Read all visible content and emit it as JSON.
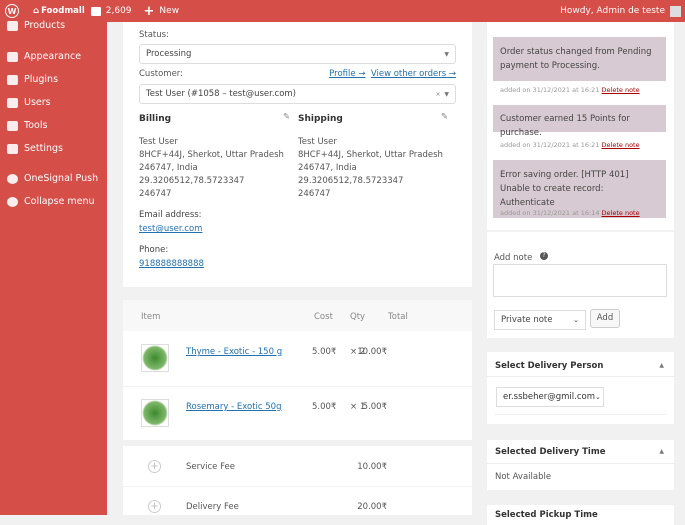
{
  "topbar": {
    "site": "Foodmall",
    "comments": "2,609",
    "new": "New",
    "greeting": "Howdy, Admin de teste"
  },
  "sidebar": {
    "items": [
      {
        "label": "Products",
        "icon": "products-icon"
      },
      {
        "label": "Appearance",
        "icon": "appearance-icon"
      },
      {
        "label": "Plugins",
        "icon": "plugins-icon"
      },
      {
        "label": "Users",
        "icon": "users-icon"
      },
      {
        "label": "Tools",
        "icon": "tools-icon"
      },
      {
        "label": "Settings",
        "icon": "settings-icon"
      },
      {
        "label": "OneSignal Push",
        "icon": "onesignal-icon"
      },
      {
        "label": "Collapse menu",
        "icon": "collapse-icon"
      }
    ]
  },
  "order": {
    "status_label": "Status:",
    "status": "Processing",
    "customer_label": "Customer:",
    "profile_link": "Profile →",
    "other_orders_link": "View other orders →",
    "customer": "Test User (#1058 – test@user.com)",
    "billing": {
      "title": "Billing",
      "lines": [
        "Test User",
        "8HCF+44J, Sherkot, Uttar Pradesh",
        "246747, India",
        "29.3206512,78.5723347",
        "246747"
      ]
    },
    "shipping": {
      "title": "Shipping",
      "lines": [
        "Test User",
        "8HCF+44J, Sherkot, Uttar Pradesh",
        "246747, India",
        "29.3206512,78.5723347",
        "246747"
      ]
    },
    "email_label": "Email address:",
    "email": "test@user.com",
    "phone_label": "Phone:",
    "phone": "918888888888"
  },
  "items": {
    "headers": {
      "item": "Item",
      "cost": "Cost",
      "qty": "Qty",
      "total": "Total"
    },
    "rows": [
      {
        "name": "Thyme - Exotic - 150 g",
        "cost": "5.00₹",
        "qty": "× 2",
        "total": "10.00₹"
      },
      {
        "name": "Rosemary - Exotic 50g",
        "cost": "5.00₹",
        "qty": "× 1",
        "total": "5.00₹"
      }
    ],
    "fees": [
      {
        "name": "Service Fee",
        "total": "10.00₹"
      },
      {
        "name": "Delivery Fee",
        "total": "20.00₹"
      }
    ]
  },
  "notes": [
    {
      "text": "Order status changed from Pending payment to Processing.",
      "meta": "added on 31/12/2021 at 16:21",
      "delete": "Delete note"
    },
    {
      "text": "Customer earned 15 Points for purchase.",
      "meta": "added on 31/12/2021 at 16:21",
      "delete": "Delete note"
    },
    {
      "text": "Error saving order. [HTTP 401] Unable to create record: Authenticate",
      "meta": "added on 31/12/2021 at 16:14",
      "delete": "Delete note"
    }
  ],
  "add_note": {
    "label": "Add note",
    "type": "Private note",
    "button": "Add"
  },
  "delivery_person": {
    "title": "Select Delivery Person",
    "value": "er.ssbeher@gmil.com"
  },
  "delivery_time": {
    "title": "Selected Delivery Time",
    "value": "Not Available"
  },
  "pickup_time": {
    "title": "Selected Pickup Time"
  }
}
